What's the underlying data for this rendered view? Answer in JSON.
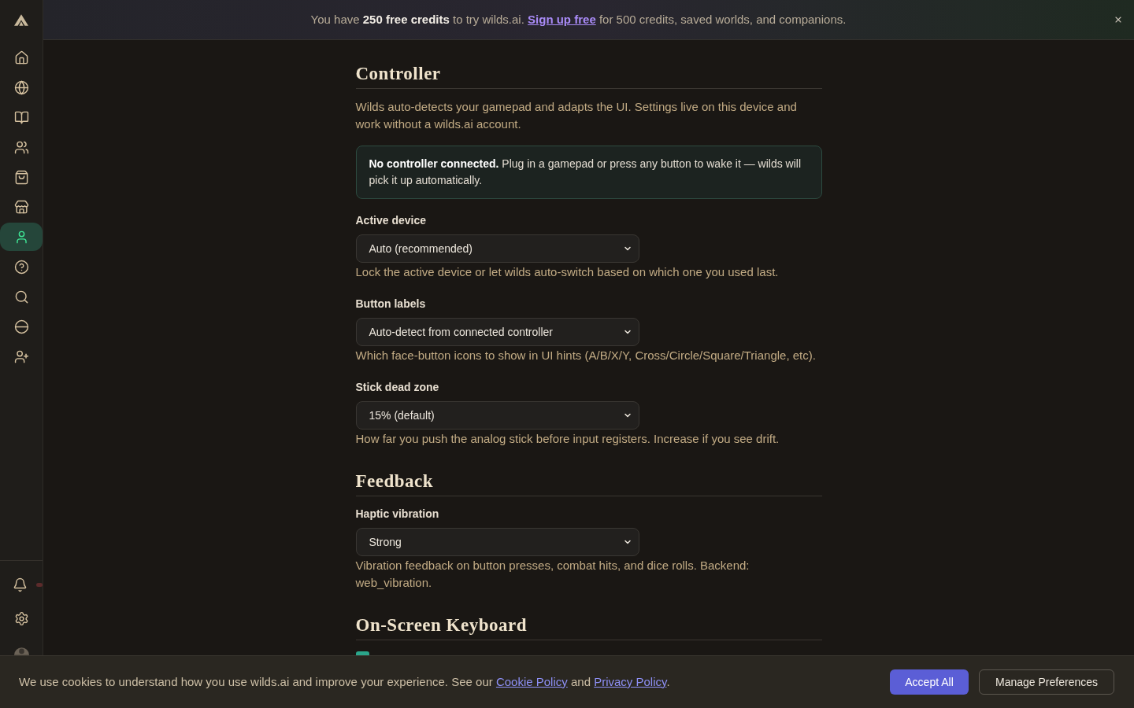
{
  "sidebar": {
    "items": [
      {
        "selected": false
      },
      {
        "selected": false
      },
      {
        "selected": false
      },
      {
        "selected": false
      },
      {
        "selected": false
      },
      {
        "selected": false
      },
      {
        "selected": true
      },
      {
        "selected": false
      },
      {
        "selected": false
      },
      {
        "selected": false
      },
      {
        "selected": false
      }
    ],
    "notifications": {
      "unread": true
    }
  },
  "banner": {
    "text": "You have **250 free credits** to try wilds.ai. ",
    "link": "Sign up free",
    "text_after": " for 500 credits, saved worlds, and companions."
  },
  "sections": [
    {
      "title": "Controller",
      "intro": "Wilds auto-detects your gamepad and adapts the UI. Settings live on this device and work without a wilds.ai account.",
      "notice": "**No controller connected.** Plug in a gamepad or press any button to wake it — wilds will pick it up automatically.",
      "fields": [
        {
          "kind": "select",
          "label": "Active device",
          "value": "Auto (recommended)",
          "hint": "Lock the active device or let wilds auto-switch based on which one you used last."
        },
        {
          "kind": "select",
          "label": "Button labels",
          "value": "Auto-detect from connected controller",
          "hint": "Which face-button icons to show in UI hints (A/B/X/Y, Cross/Circle/Square/Triangle, etc)."
        },
        {
          "kind": "select",
          "label": "Stick dead zone",
          "value": "15% (default)",
          "hint": "How far you push the analog stick before input registers. Increase if you see drift."
        }
      ]
    },
    {
      "title": "Feedback",
      "fields": [
        {
          "kind": "select",
          "label": "Haptic vibration",
          "value": "Strong",
          "hint": "Vibration feedback on button presses, combat hits, and dice rolls. Backend: web_vibration."
        }
      ]
    },
    {
      "title": "On-Screen Keyboard",
      "fields": [
        {
          "kind": "checkbox",
          "checked": true
        }
      ]
    }
  ],
  "cookie_bar": {
    "parts": [
      {
        "kind": "text",
        "text": "We use cookies to understand how you use wilds.ai and improve your experience. See our "
      },
      {
        "kind": "link",
        "text": "Cookie Policy"
      },
      {
        "kind": "text",
        "text": " and "
      },
      {
        "kind": "link",
        "text": "Privacy Policy"
      },
      {
        "kind": "text",
        "text": "."
      }
    ],
    "buttons": [
      {
        "kind": "primary",
        "label": "Accept All"
      },
      {
        "kind": "secondary",
        "label": "Manage Preferences"
      }
    ]
  }
}
